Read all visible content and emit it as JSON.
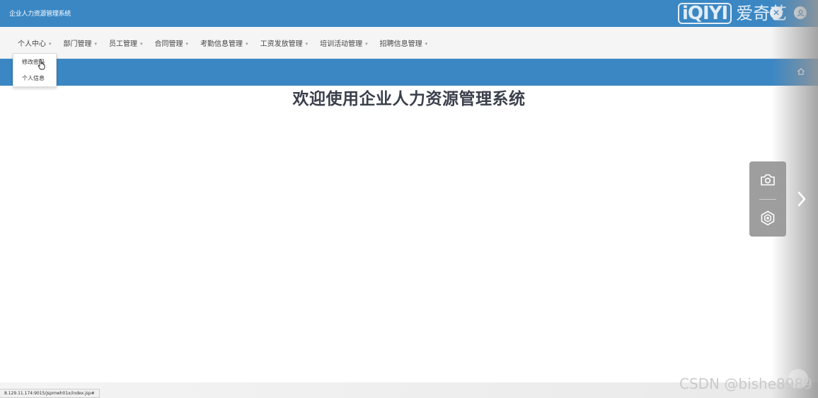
{
  "header": {
    "app_title": "企业人力资源管理系统",
    "brand_logo_latin": "iQIYI",
    "brand_logo_cjk": "爱奇艺",
    "close_label": "✕"
  },
  "nav": {
    "items": [
      {
        "label": "个人中心"
      },
      {
        "label": "部门管理"
      },
      {
        "label": "员工管理"
      },
      {
        "label": "合同管理"
      },
      {
        "label": "考勤信息管理"
      },
      {
        "label": "工资发放管理"
      },
      {
        "label": "培训活动管理"
      },
      {
        "label": "招聘信息管理"
      }
    ],
    "caret": "▾"
  },
  "dropdown": {
    "items": [
      {
        "label": "修改密码"
      },
      {
        "label": "个人信息"
      }
    ]
  },
  "main": {
    "welcome_text": "欢迎使用企业人力资源管理系统"
  },
  "status_bar": {
    "url": "8.129.11.174:9015/jspmwh01x/index.jsp#"
  },
  "watermark": {
    "text": "CSDN @bishe8989"
  },
  "colors": {
    "primary_blue": "#3a87c4",
    "navbar_bg": "#f5f5f5",
    "title_text": "#3a3f4b"
  },
  "icons": {
    "user": "user-icon",
    "home": "home-icon",
    "camera": "camera-icon",
    "target": "target-icon",
    "arrow": "chevron-right-icon"
  }
}
